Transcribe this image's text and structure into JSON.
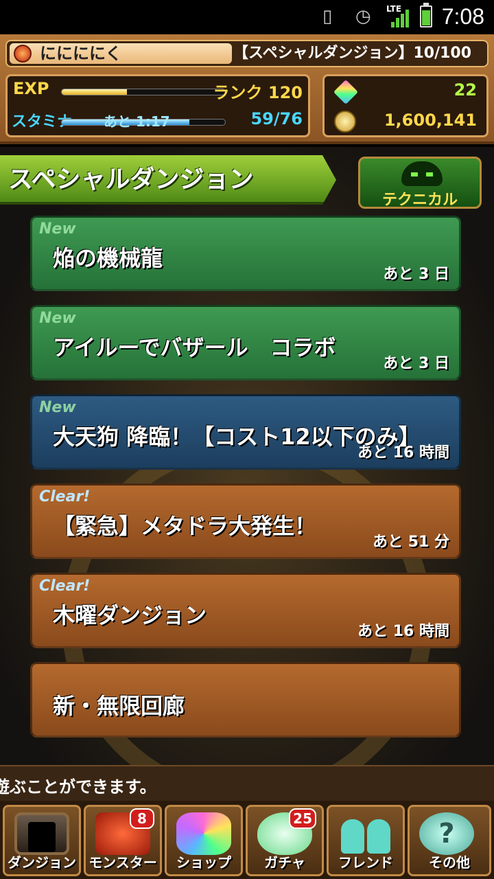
{
  "status_bar": {
    "time": "7:08",
    "network": "LTE",
    "icons": [
      "vibrate-icon",
      "alarm-icon",
      "signal-icon",
      "battery-icon"
    ],
    "battery_level": 0.8
  },
  "player": {
    "name": "ににににく",
    "dungeon_status": "【スペシャルダンジョン】10/100",
    "exp_label": "EXP",
    "exp_progress": 0.4,
    "rank": "ランク 120",
    "stamina_label": "スタミナ",
    "stamina_timer": "あと 1:17",
    "stamina": "59/76",
    "stamina_progress": 0.78,
    "magic_stones": "22",
    "coins": "1,600,141"
  },
  "header": {
    "title": "スペシャルダンジョン",
    "technical_button": "テクニカル"
  },
  "dungeons": [
    {
      "tag": "New",
      "title": "焔の機械龍",
      "remaining": "あと 3 日",
      "style": "green"
    },
    {
      "tag": "New",
      "title": "アイルーでバザール　コラボ",
      "remaining": "あと 3 日",
      "style": "green"
    },
    {
      "tag": "New",
      "title": "大天狗 降臨！【コスト12以下のみ】",
      "remaining": "あと 16 時間",
      "style": "blue"
    },
    {
      "tag": "Clear!",
      "title": "【緊急】メタドラ大発生！",
      "remaining": "あと 51 分",
      "style": "brown"
    },
    {
      "tag": "Clear!",
      "title": "木曜ダンジョン",
      "remaining": "あと 16 時間",
      "style": "brown"
    },
    {
      "tag": "",
      "title": "新・無限回廊",
      "remaining": "",
      "style": "brown"
    }
  ],
  "ticker": "遊ぶことができます。",
  "nav": [
    {
      "label": "ダンジョン",
      "badge": ""
    },
    {
      "label": "モンスター",
      "badge": "8"
    },
    {
      "label": "ショップ",
      "badge": ""
    },
    {
      "label": "ガチャ",
      "badge": "25"
    },
    {
      "label": "フレンド",
      "badge": ""
    },
    {
      "label": "その他",
      "badge": ""
    }
  ],
  "colors": {
    "accent_green": "#4f8a16",
    "new_green": "#257238",
    "new_blue": "#1c3e5e",
    "clear_brown": "#8a4a1c",
    "exp_gold": "#ffd84a",
    "stamina_cyan": "#4ad6ff"
  }
}
